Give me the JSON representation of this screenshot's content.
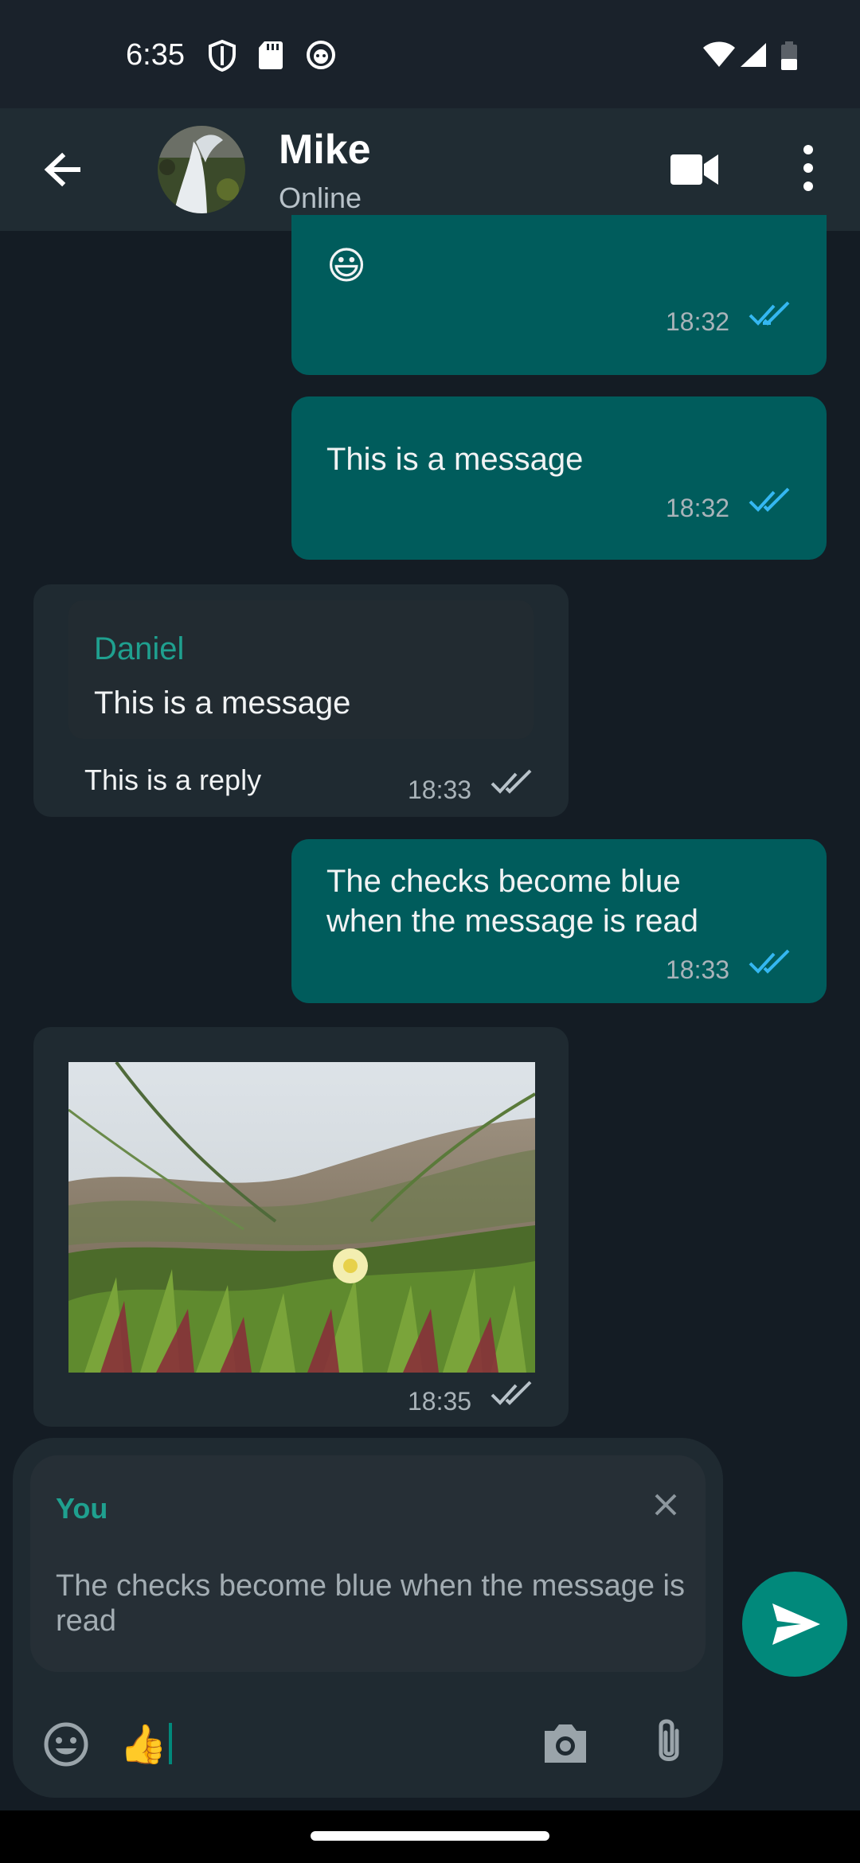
{
  "status_bar": {
    "time": "6:35"
  },
  "header": {
    "contact_name": "Mike",
    "contact_status": "Online"
  },
  "messages": [
    {
      "direction": "out",
      "text": "😃",
      "time": "18:32",
      "status": "read"
    },
    {
      "direction": "out",
      "text": "This is a message",
      "time": "18:32",
      "status": "read"
    },
    {
      "direction": "in",
      "quote_author": "Daniel",
      "quote_text": "This is a message",
      "text": "This is a reply",
      "time": "18:33",
      "status": "delivered"
    },
    {
      "direction": "out",
      "text_lines": [
        "The checks become blue",
        "when the message is read"
      ],
      "time": "18:33",
      "status": "read"
    },
    {
      "direction": "in",
      "type": "image",
      "image_desc": "photo",
      "time": "18:35",
      "status": "delivered"
    }
  ],
  "composer": {
    "reply_author": "You",
    "reply_text_lines": [
      "The checks become blue when the message is",
      "read"
    ],
    "input_value": "👍"
  },
  "colors": {
    "accent": "#01897b",
    "outgoing_bubble": "#005c5c",
    "incoming_bubble": "#1f2a31",
    "read_check": "#34b7f1",
    "quote_name": "#1fa08f"
  }
}
